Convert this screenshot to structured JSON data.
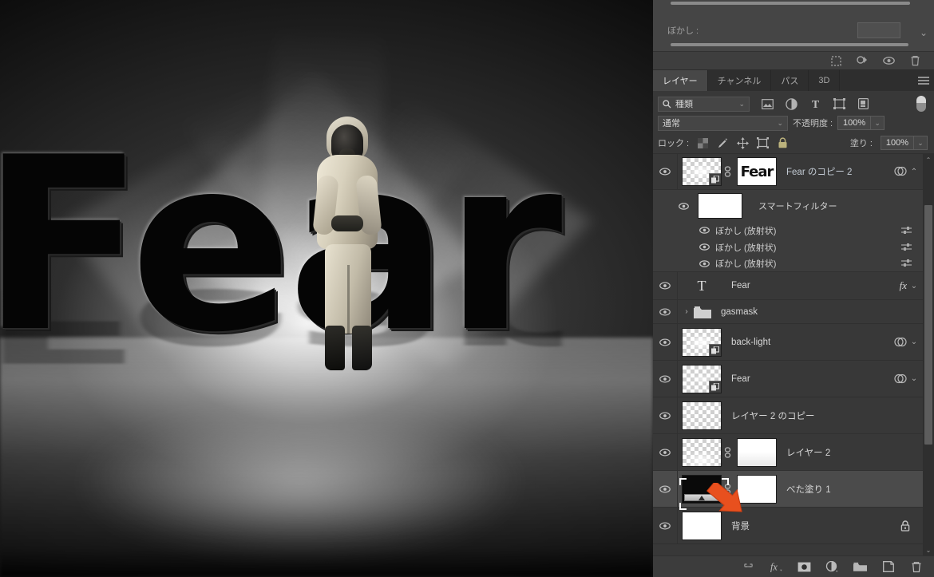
{
  "canvas": {
    "artwork_text": "Fear",
    "subject": "person-in-hazmat-suit-with-gas-mask"
  },
  "properties_panel": {
    "feather_label": "ぼかし :",
    "feather_value": "",
    "footer_icons": [
      "selection-icon",
      "load-selection-icon",
      "eye-icon",
      "trash-icon"
    ]
  },
  "panel_tabs": [
    {
      "label": "レイヤー",
      "active": true
    },
    {
      "label": "チャンネル",
      "active": false
    },
    {
      "label": "パス",
      "active": false
    },
    {
      "label": "3D",
      "active": false
    }
  ],
  "panel_menu": "hamburger-menu-icon",
  "filter_bar": {
    "kind_label": "種類",
    "icons": [
      "pixel-filter-icon",
      "adjustment-filter-icon",
      "type-filter-icon",
      "shape-filter-icon",
      "smartobject-filter-icon"
    ],
    "toggle": "filter-enable-toggle"
  },
  "blend_row": {
    "blend_mode": "通常",
    "opacity_label": "不透明度 :",
    "opacity_value": "100%"
  },
  "lock_row": {
    "lock_label": "ロック :",
    "lock_icons": [
      "lock-transparency-icon",
      "lock-image-icon",
      "lock-position-icon",
      "lock-artboard-icon",
      "lock-all-icon"
    ],
    "fill_label": "塗り :",
    "fill_value": "100%"
  },
  "layers": [
    {
      "name": "Fear のコピー 2",
      "type": "smart-object-with-mask",
      "visible": true,
      "selected": false,
      "linked": true,
      "mask_text": "Fear",
      "has_smart_indicator": true,
      "has_chevron": true
    },
    {
      "name": "スマートフィルター",
      "type": "smart-filter-header",
      "visible": true
    },
    {
      "name": "ぼかし (放射状)",
      "type": "smart-filter",
      "visible": true
    },
    {
      "name": "ぼかし (放射状)",
      "type": "smart-filter",
      "visible": true
    },
    {
      "name": "ぼかし (放射状)",
      "type": "smart-filter",
      "visible": true
    },
    {
      "name": "Fear",
      "type": "text",
      "visible": true,
      "selected": false,
      "effects_label": "fx",
      "has_chevron": true
    },
    {
      "name": "gasmask",
      "type": "group",
      "visible": true,
      "selected": false,
      "collapsed": true
    },
    {
      "name": "back-light",
      "type": "smart-object",
      "visible": true,
      "selected": false,
      "has_smart_indicator": true,
      "has_chevron": true
    },
    {
      "name": "Fear",
      "type": "smart-object",
      "visible": true,
      "selected": false,
      "has_smart_indicator": true,
      "has_chevron": true
    },
    {
      "name": "レイヤー 2 のコピー",
      "type": "pixel",
      "visible": true,
      "selected": false
    },
    {
      "name": "レイヤー 2",
      "type": "pixel-with-mask",
      "visible": true,
      "selected": false,
      "linked": true
    },
    {
      "name": "べた塗り 1",
      "type": "solid-color-fill-with-mask",
      "visible": true,
      "selected": true,
      "linked": true,
      "annotated": true
    },
    {
      "name": "背景",
      "type": "background",
      "visible": true,
      "selected": false,
      "locked": true
    }
  ],
  "layer_toolbar": {
    "icons": [
      "link-layers-icon",
      "layer-style-fx-icon",
      "add-mask-icon",
      "adjustment-layer-icon",
      "new-group-icon",
      "new-layer-icon",
      "delete-layer-icon"
    ]
  },
  "annotation": {
    "arrow": "red-arrow-pointing-at-solid-fill-thumbnail",
    "arrow_color": "#e8501e"
  },
  "colors": {
    "panel_bg": "#383838",
    "panel_dark": "#2e2e2e",
    "row_selected": "#4b4b4b",
    "text": "#d6d6d6",
    "accent_blue": "#c3cbd4"
  }
}
